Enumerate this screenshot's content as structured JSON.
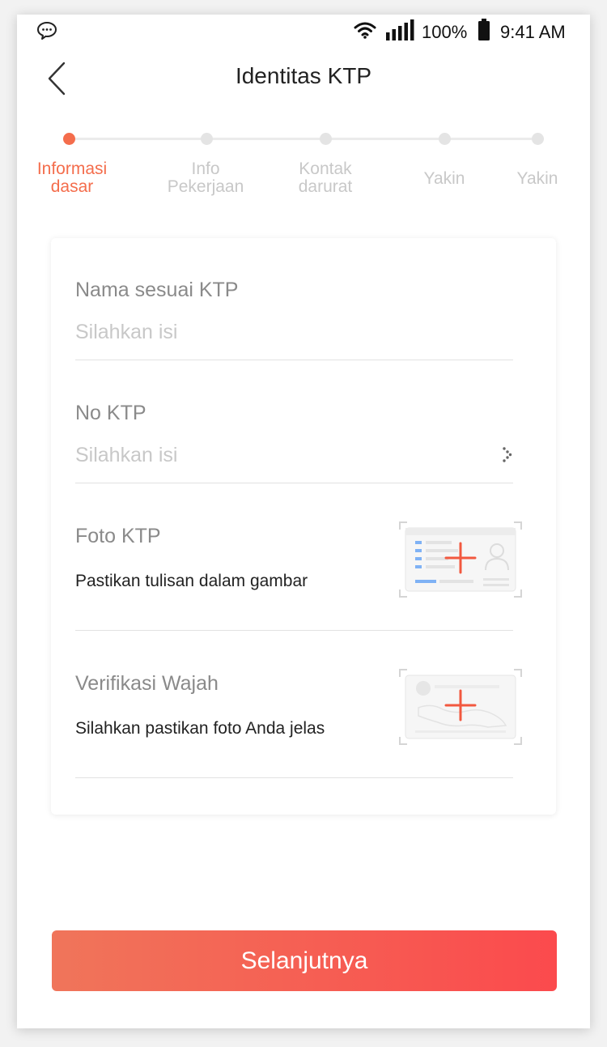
{
  "status_bar": {
    "battery": "100%",
    "time": "9:41 AM"
  },
  "header": {
    "title": "Identitas KTP"
  },
  "stepper": {
    "steps": [
      {
        "label": "Informasi dasar",
        "active": true
      },
      {
        "label": "Info Pekerjaan",
        "active": false
      },
      {
        "label": "Kontak darurat",
        "active": false
      },
      {
        "label": "Yakin",
        "active": false
      },
      {
        "label": "Yakin",
        "active": false
      }
    ]
  },
  "form": {
    "name": {
      "label": "Nama sesuai KTP",
      "placeholder": "Silahkan isi",
      "value": ""
    },
    "ktp_number": {
      "label": "No KTP",
      "placeholder": "Silahkan isi",
      "value": ""
    },
    "ktp_photo": {
      "label": "Foto KTP",
      "hint": "Pastikan tulisan dalam gambar"
    },
    "face": {
      "label": "Verifikasi Wajah",
      "hint": "Silahkan pastikan foto Anda jelas"
    }
  },
  "actions": {
    "next_label": "Selanjutnya"
  },
  "colors": {
    "accent": "#f46d4c",
    "button_start": "#f0755a",
    "button_end": "#fb4a4d"
  }
}
